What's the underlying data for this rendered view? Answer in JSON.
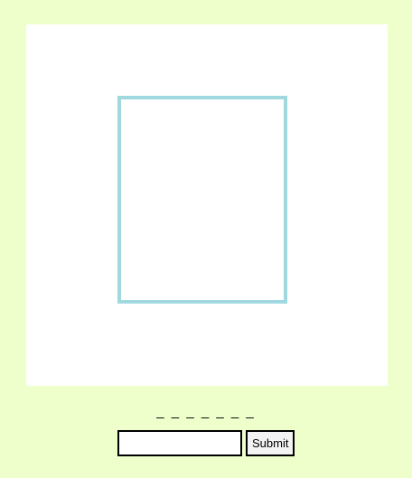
{
  "game": {
    "word_blanks": "_ _ _ _ _ _ _",
    "guess_value": "",
    "submit_label": "Submit"
  },
  "colors": {
    "background": "#eeffcc",
    "board": "#ffffff",
    "frame_border": "#a0d8e0"
  }
}
